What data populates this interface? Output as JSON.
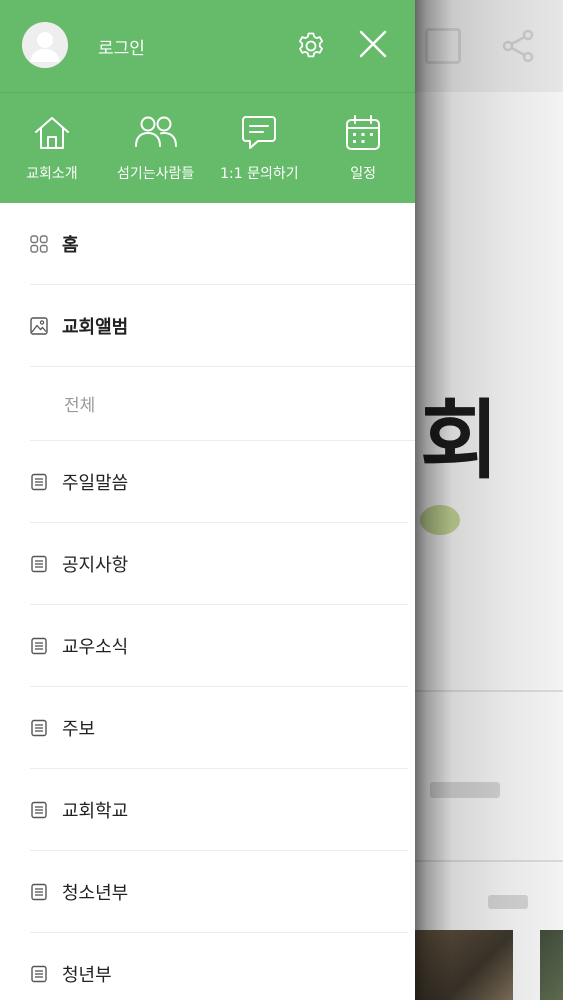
{
  "header": {
    "login_label": "로그인",
    "accent_color": "#66bb6a"
  },
  "quick_menu": [
    {
      "label": "교회소개",
      "icon": "home-icon"
    },
    {
      "label": "섬기는사람들",
      "icon": "people-icon"
    },
    {
      "label": "1:1 문의하기",
      "icon": "chat-icon"
    },
    {
      "label": "일정",
      "icon": "calendar-icon"
    }
  ],
  "menu": {
    "home": {
      "label": "홈",
      "icon": "grid-icon"
    },
    "album": {
      "label": "교회앨범",
      "icon": "image-icon"
    },
    "album_all": {
      "label": "전체"
    },
    "items": [
      {
        "label": "주일말씀",
        "icon": "document-icon"
      },
      {
        "label": "공지사항",
        "icon": "document-icon"
      },
      {
        "label": "교우소식",
        "icon": "document-icon"
      },
      {
        "label": "주보",
        "icon": "document-icon"
      },
      {
        "label": "교회학교",
        "icon": "document-icon"
      },
      {
        "label": "청소년부",
        "icon": "document-icon"
      },
      {
        "label": "청년부",
        "icon": "document-icon"
      }
    ]
  }
}
